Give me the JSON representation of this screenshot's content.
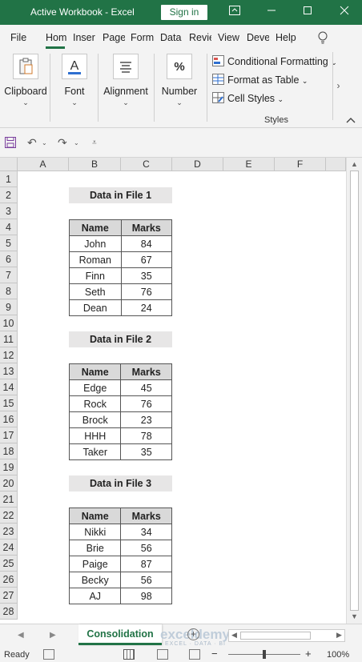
{
  "titlebar": {
    "title": "Active Workbook  -  Excel",
    "signin_label": "Sign in",
    "ribbon_display_icon": "ribbon-display-icon",
    "minimize_icon": "minimize-icon",
    "restore_icon": "restore-icon",
    "close_icon": "close-icon"
  },
  "tabs": [
    "File",
    "Hom",
    "Inser",
    "Page",
    "Form",
    "Data",
    "Revie",
    "View",
    "Deve",
    "Help"
  ],
  "active_tab": "Hom",
  "ribbon": {
    "groups": [
      {
        "label": "Clipboard",
        "icon": "clipboard-icon"
      },
      {
        "label": "Font",
        "icon": "font-icon",
        "glyph": "A"
      },
      {
        "label": "Alignment",
        "icon": "alignment-icon"
      },
      {
        "label": "Number",
        "icon": "number-icon",
        "glyph": "%"
      }
    ],
    "styles_items": [
      "Conditional Formatting",
      "Format as Table",
      "Cell Styles"
    ],
    "styles_group_label": "Styles"
  },
  "qat": {
    "save_icon": "save-icon",
    "undo_icon": "undo-icon",
    "redo_icon": "redo-icon",
    "customize_icon": "customize-qat-icon"
  },
  "columns": [
    "A",
    "B",
    "C",
    "D",
    "E",
    "F"
  ],
  "rows": [
    "1",
    "2",
    "3",
    "4",
    "5",
    "6",
    "7",
    "8",
    "9",
    "10",
    "11",
    "12",
    "13",
    "14",
    "15",
    "16",
    "17",
    "18",
    "19",
    "20",
    "21",
    "22",
    "23",
    "24",
    "25",
    "26",
    "27",
    "28"
  ],
  "sections": [
    {
      "title": "Data in File 1",
      "headers": [
        "Name",
        "Marks"
      ],
      "rows": [
        [
          "John",
          "84"
        ],
        [
          "Roman",
          "67"
        ],
        [
          "Finn",
          "35"
        ],
        [
          "Seth",
          "76"
        ],
        [
          "Dean",
          "24"
        ]
      ]
    },
    {
      "title": "Data in File 2",
      "headers": [
        "Name",
        "Marks"
      ],
      "rows": [
        [
          "Edge",
          "45"
        ],
        [
          "Rock",
          "76"
        ],
        [
          "Brock",
          "23"
        ],
        [
          "HHH",
          "78"
        ],
        [
          "Taker",
          "35"
        ]
      ]
    },
    {
      "title": "Data in File 3",
      "headers": [
        "Name",
        "Marks"
      ],
      "rows": [
        [
          "Nikki",
          "34"
        ],
        [
          "Brie",
          "56"
        ],
        [
          "Paige",
          "87"
        ],
        [
          "Becky",
          "56"
        ],
        [
          "AJ",
          "98"
        ]
      ]
    }
  ],
  "sheet_tab": "Consolidation",
  "watermark": {
    "text": "exceldemy",
    "sub": "EXCEL · DATA · BI"
  },
  "status": {
    "ready": "Ready",
    "zoom": "100%"
  },
  "colors": {
    "accent": "#217346",
    "header_fill": "#d9d9d9",
    "title_fill": "#e7e6e6"
  }
}
